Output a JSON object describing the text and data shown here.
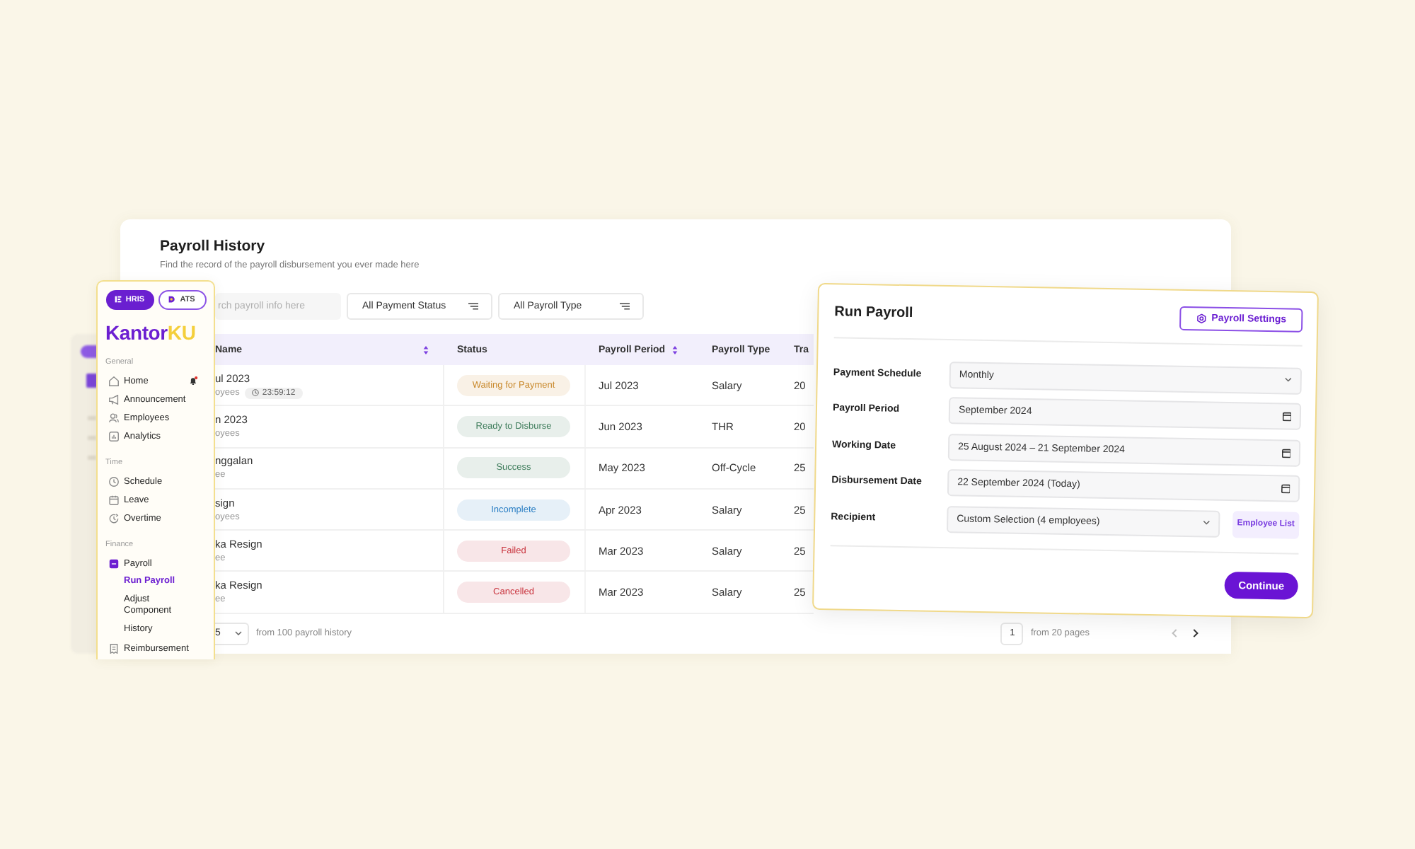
{
  "payroll_history": {
    "title": "Payroll History",
    "subtitle": "Find the record of the payroll disbursement you ever made here",
    "search": {
      "placeholder": "rch payroll info here"
    },
    "filters": [
      {
        "label": "All Payment Status"
      },
      {
        "label": "All Payroll Type"
      }
    ],
    "table": {
      "columns": [
        {
          "label": "Name",
          "sortable": true
        },
        {
          "label": "Status",
          "sortable": false
        },
        {
          "label": "Payroll Period",
          "sortable": true
        },
        {
          "label": "Payroll Type",
          "sortable": false
        },
        {
          "label": "Tra",
          "sortable": false
        }
      ],
      "rows": [
        {
          "name": "ul 2023",
          "detail": "oyees",
          "timer": "23:59:12",
          "status": {
            "text": "Waiting for Payment",
            "color": "#c98a2e"
          },
          "period": "Jul 2023",
          "type": "Salary",
          "column_5": "20"
        },
        {
          "name": "n 2023",
          "detail": "oyees",
          "status": {
            "text": "Ready to Disburse",
            "color": "#3f7d5c"
          },
          "period": "Jun 2023",
          "type": "THR",
          "column_5": "20"
        },
        {
          "name": "nggalan",
          "detail": "ee",
          "status": {
            "text": "Success",
            "color": "#3f7d5c"
          },
          "period": "May 2023",
          "type": "Off-Cycle",
          "column_5": "25"
        },
        {
          "name": "sign",
          "detail": "oyees",
          "status": {
            "text": "Incomplete",
            "color": "#2b7fc4"
          },
          "period": "Apr 2023",
          "type": "Salary",
          "column_5": "25"
        },
        {
          "name": "ka Resign",
          "detail": "ee",
          "status": {
            "text": "Failed",
            "color": "#c8323c"
          },
          "period": "Mar 2023",
          "type": "Salary",
          "column_5": "25"
        },
        {
          "name": "ka Resign",
          "detail": "ee",
          "status": {
            "text": "Cancelled",
            "color": "#c8323c"
          },
          "period": "Mar 2023",
          "type": "Salary",
          "column_5": "25"
        }
      ]
    },
    "footer": {
      "page_size": "5",
      "total": "from 100 payroll history",
      "page": "1",
      "pages": "from 20 pages",
      "previous_disabled": true,
      "next_disabled": false
    }
  },
  "sidebar": {
    "modules": [
      {
        "label": "HRIS",
        "selected": true
      },
      {
        "label": "ATS",
        "selected": false
      }
    ],
    "logo": {
      "main": "Kantor",
      "accent": "KU"
    },
    "sections": [
      {
        "title": "General",
        "items": [
          {
            "label": "Home",
            "selected": false,
            "notification": true
          },
          {
            "label": "Announcement",
            "selected": false,
            "notification": false
          },
          {
            "label": "Employees",
            "selected": false,
            "notification": false
          },
          {
            "label": "Analytics",
            "selected": false,
            "notification": false
          }
        ]
      },
      {
        "title": "Time",
        "items": [
          {
            "label": "Schedule",
            "selected": false,
            "notification": false
          },
          {
            "label": "Leave",
            "selected": false,
            "notification": false
          },
          {
            "label": "Overtime",
            "selected": false,
            "notification": false
          }
        ]
      },
      {
        "title": "Finance",
        "items": [
          {
            "label": "Payroll",
            "selected": false,
            "notification": false,
            "children": [
              {
                "label": "Run Payroll",
                "selected": true
              },
              {
                "label": "Adjust Component",
                "selected": false
              },
              {
                "label": "History",
                "selected": false
              }
            ]
          },
          {
            "label": "Reimbursement",
            "selected": false,
            "notification": false
          }
        ]
      }
    ]
  },
  "run_payroll": {
    "title": "Run Payroll",
    "settings_button": "Payroll Settings",
    "fields": [
      {
        "label": "Payment Schedule",
        "kind": "select",
        "value": "Monthly"
      },
      {
        "label": "Payroll Period",
        "kind": "date",
        "value": "September 2024"
      },
      {
        "label": "Working Date",
        "kind": "date",
        "value": "25 August 2024 – 21 September 2024"
      },
      {
        "label": "Disbursement Date",
        "kind": "date",
        "value": "22 September 2024 (Today)"
      },
      {
        "label": "Recipient",
        "kind": "select",
        "value": "Custom Selection (4 employees)",
        "button": "Employee List"
      }
    ],
    "primary_button": "Continue"
  }
}
